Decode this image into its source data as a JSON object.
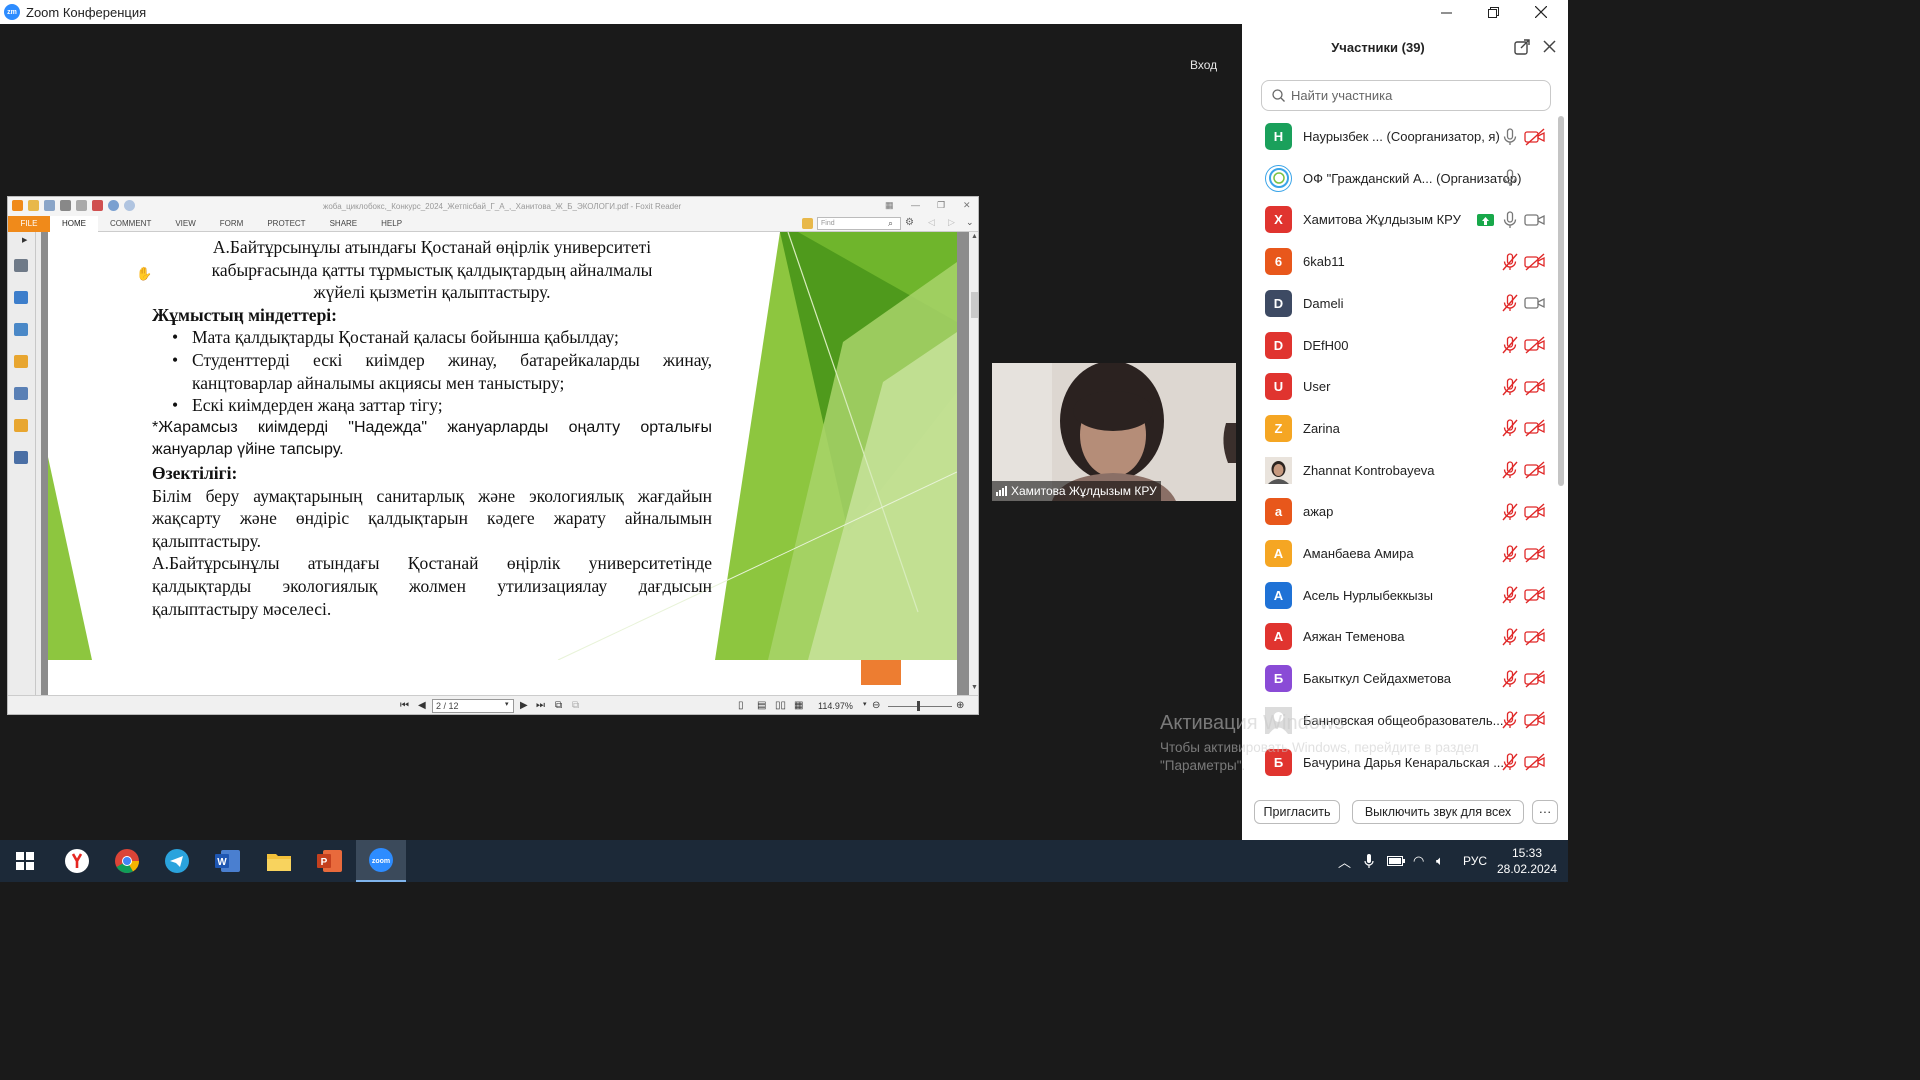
{
  "window": {
    "title": "Zoom Конференция",
    "logo_text": "zm"
  },
  "stage": {
    "enter_label": "Вход"
  },
  "foxit": {
    "doc_title": "жоба_циклобокс,_Конкурс_2024_Жетпісбай_Г_А_,_Ханитова_Ж_Б_ЭКОЛОГИ.pdf - Foxit Reader",
    "tabs": [
      "FILE",
      "HOME",
      "COMMENT",
      "VIEW",
      "FORM",
      "PROTECT",
      "SHARE",
      "HELP"
    ],
    "find_placeholder": "Find",
    "page_indicator": "2 / 12",
    "zoom": "114.97%"
  },
  "slide": {
    "line1": "А.Байтұрсынұлы атындағы Қостанай өңірлік университеті",
    "line2": "кабырғасында қатты тұрмыстық қалдықтардың айналмалы",
    "line3": "жүйелі қызметін қалыптастыру.",
    "tasks_heading": "Жұмыстың міндеттері:",
    "tasks": [
      "Мата қалдықтарды Қостанай қаласы бойынша қабылдау;",
      "Студенттерді ескі киімдер жинау, батарейкаларды жинау, канцтоварлар айналымы акциясы мен таныстыру;",
      "Ескі киімдерден жаңа заттар тігу;"
    ],
    "note": "*Жарамсыз киімдерді \"Надежда\" жануарларды оңалту орталығы жануарлар үйіне тапсыру.",
    "relevance_heading": "Өзектілігі:",
    "relevance_p1": "Білім беру аумақтарының санитарлық және экологиялық жағдайын жақсарту және өндіріс қалдықтарын кәдеге жарату айналымын қалыптастыру.",
    "relevance_p2": "А.Байтұрсынұлы атындағы  Қостанай өңірлік университетінде қалдықтарды экологиялық жолмен утилизациялау дағдысын қалыптастыру мәселесі."
  },
  "video": {
    "name": "Хамитова Жұлдызым КРУ"
  },
  "watermark": {
    "line1": "Активация Windows",
    "line2": "Чтобы активировать Windows, перейдите в раздел",
    "line3": "\"Параметры\"."
  },
  "panel": {
    "title": "Участники (39)",
    "search_placeholder": "Найти участника",
    "participants": [
      {
        "initial": "Н",
        "name": "Наурызбек ...",
        "role": "(Соорганизатор, я)",
        "color": "#1aa05b",
        "mic": "on",
        "cam": "off"
      },
      {
        "initial": "",
        "name": "ОФ \"Гражданский А...",
        "role": "(Организатор)",
        "color": "#ffffff",
        "mic": "on",
        "cam": "none"
      },
      {
        "initial": "Х",
        "name": "Хамитова Жұлдызым КРУ",
        "role": "",
        "color": "#e0342f",
        "mic": "on",
        "cam": "on"
      },
      {
        "initial": "6",
        "name": "6kab11",
        "role": "",
        "color": "#e8571b",
        "mic": "off",
        "cam": "off"
      },
      {
        "initial": "D",
        "name": "Dameli",
        "role": "",
        "color": "#3d4a63",
        "mic": "off",
        "cam": "on"
      },
      {
        "initial": "D",
        "name": "DEfH00",
        "role": "",
        "color": "#e0342f",
        "mic": "off",
        "cam": "off"
      },
      {
        "initial": "U",
        "name": "User",
        "role": "",
        "color": "#e0342f",
        "mic": "off",
        "cam": "off"
      },
      {
        "initial": "Z",
        "name": "Zarina",
        "role": "",
        "color": "#f5a623",
        "mic": "off",
        "cam": "off"
      },
      {
        "initial": "",
        "name": "Zhannat Kontrobayeva",
        "role": "",
        "color": "#c9a07e",
        "mic": "off",
        "cam": "off"
      },
      {
        "initial": "а",
        "name": "ажар",
        "role": "",
        "color": "#e8571b",
        "mic": "off",
        "cam": "off"
      },
      {
        "initial": "А",
        "name": "Аманбаева Амира",
        "role": "",
        "color": "#f5a623",
        "mic": "off",
        "cam": "off"
      },
      {
        "initial": "А",
        "name": "Асель Нурлыбеккызы",
        "role": "",
        "color": "#1f72d6",
        "mic": "off",
        "cam": "off"
      },
      {
        "initial": "А",
        "name": "Аяжан Теменова",
        "role": "",
        "color": "#e0342f",
        "mic": "off",
        "cam": "off"
      },
      {
        "initial": "Б",
        "name": "Бакыткул Сейдахметова",
        "role": "",
        "color": "#8a4bd6",
        "mic": "off",
        "cam": "off"
      },
      {
        "initial": "",
        "name": "Банновская общеобразователь...",
        "role": "",
        "color": "#d9d9d9",
        "mic": "off",
        "cam": "off"
      },
      {
        "initial": "Б",
        "name": "Бачурина Дарья Кенаральская ...",
        "role": "",
        "color": "#e0342f",
        "mic": "off",
        "cam": "off"
      }
    ],
    "invite_label": "Пригласить",
    "mute_all_label": "Выключить звук для всех",
    "more_label": "···"
  },
  "taskbar": {
    "language": "РУС",
    "time": "15:33",
    "date": "28.02.2024"
  }
}
